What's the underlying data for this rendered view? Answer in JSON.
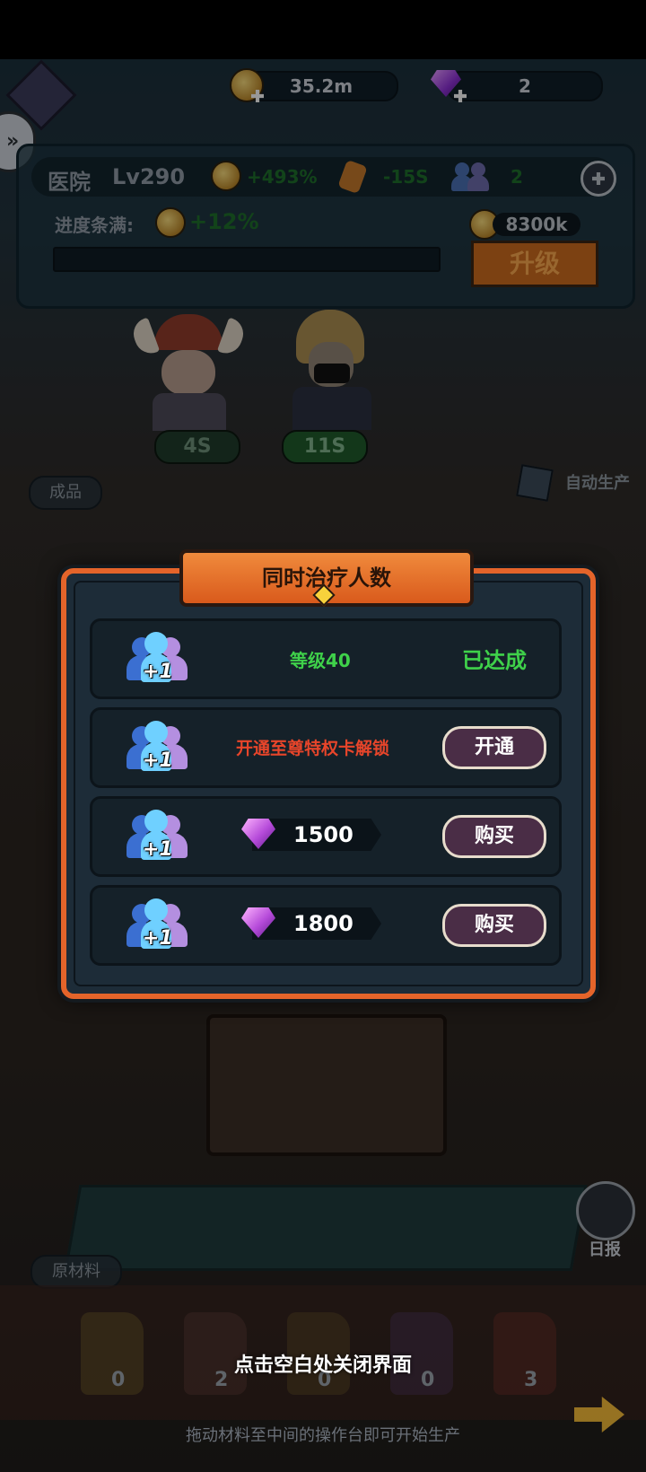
{
  "currency": {
    "gold": "35.2m",
    "gems": "2"
  },
  "building": {
    "name": "医院",
    "level": "Lv290",
    "bonus": "+493%",
    "time_bonus": "-15S",
    "workers": "2",
    "progress_label": "进度条满:",
    "progress_bonus": "+12%",
    "progress": 0,
    "upgrade_cost": "8300k",
    "upgrade_label": "升级"
  },
  "staff": [
    {
      "timer": "4S"
    },
    {
      "timer": "11S"
    }
  ],
  "sections": {
    "products": "成品",
    "auto_produce": "自动生产",
    "materials": "原材料",
    "daily_report": "日报"
  },
  "modal": {
    "title": "同时治疗人数",
    "plus_label": "+1",
    "rows": [
      {
        "requirement": "等级40",
        "status": "已达成"
      },
      {
        "requirement": "开通至尊特权卡解锁",
        "button": "开通"
      },
      {
        "price": "1500",
        "button": "购买"
      },
      {
        "price": "1800",
        "button": "购买"
      }
    ]
  },
  "materials": [
    "0",
    "2",
    "0",
    "0",
    "3"
  ],
  "hints": {
    "close": "点击空白处关闭界面",
    "drag": "拖动材料至中间的操作台即可开始生产"
  },
  "colors": {
    "accent_orange": "#e4642a",
    "status_green": "#3fd14a",
    "locked_red": "#e8452a",
    "button_purple": "#4a2d46"
  }
}
